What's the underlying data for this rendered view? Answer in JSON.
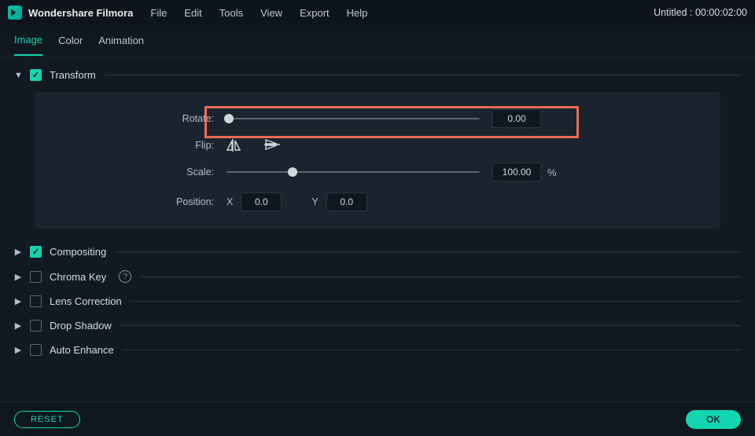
{
  "app": {
    "title": "Wondershare Filmora",
    "project": "Untitled : 00:00:02:00"
  },
  "menu": {
    "file": "File",
    "edit": "Edit",
    "tools": "Tools",
    "view": "View",
    "export": "Export",
    "help": "Help"
  },
  "tabs": {
    "image": "Image",
    "color": "Color",
    "animation": "Animation"
  },
  "sections": {
    "transform": "Transform",
    "compositing": "Compositing",
    "chroma": "Chroma Key",
    "lens": "Lens Correction",
    "drop": "Drop Shadow",
    "auto": "Auto Enhance"
  },
  "transform": {
    "rotate_label": "Rotate:",
    "rotate_value": "0.00",
    "flip_label": "Flip:",
    "scale_label": "Scale:",
    "scale_value": "100.00",
    "scale_unit": "%",
    "position_label": "Position:",
    "x_label": "X",
    "x_value": "0.0",
    "y_label": "Y",
    "y_value": "0.0"
  },
  "footer": {
    "reset": "RESET",
    "ok": "OK"
  }
}
